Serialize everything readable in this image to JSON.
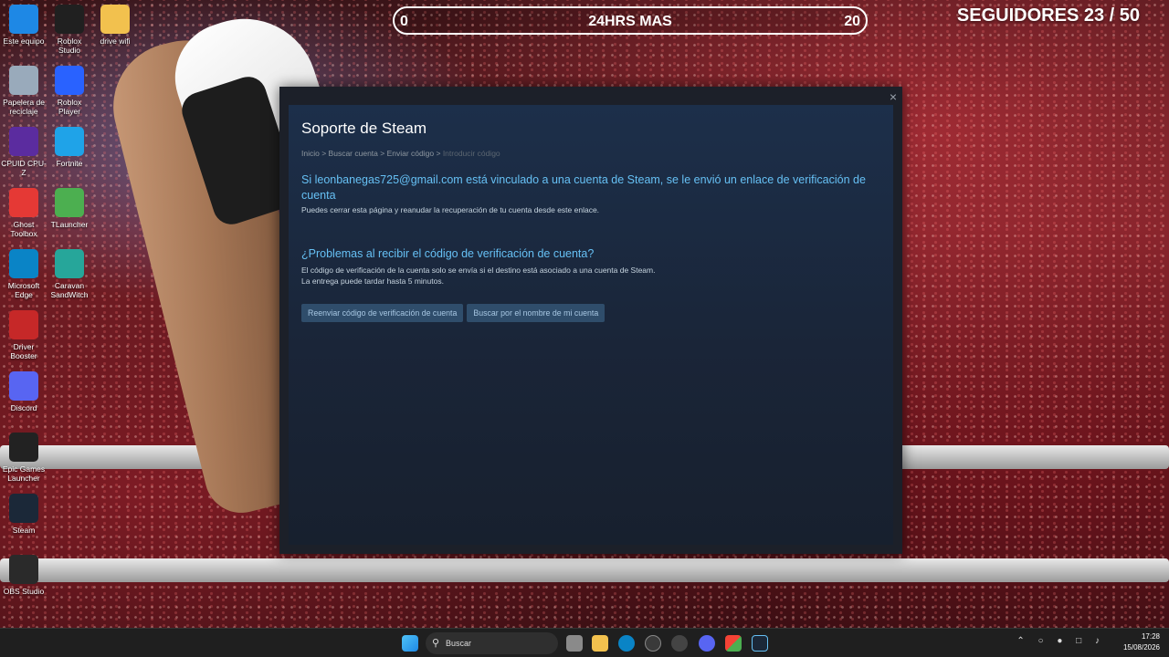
{
  "overlay": {
    "timer_left": "0",
    "timer_title": "24HRS MAS",
    "timer_right": "20",
    "followers": "SEGUIDORES 23 / 50"
  },
  "desktop_icons": [
    {
      "label": "Este equipo",
      "icon": "monitor-icon",
      "color": "#1e88e5"
    },
    {
      "label": "Roblox Studio",
      "icon": "roblox-studio-icon",
      "color": "#202020"
    },
    {
      "label": "drive wifi",
      "icon": "folder-icon",
      "color": "#f2c14e"
    },
    {
      "label": "Papelera de reciclaje",
      "icon": "recycle-bin-icon",
      "color": "#9ab"
    },
    {
      "label": "Roblox Player",
      "icon": "roblox-player-icon",
      "color": "#2962ff"
    },
    {
      "label": "CPUID CPU-Z",
      "icon": "cpu-z-icon",
      "color": "#5b2c9f"
    },
    {
      "label": "Fortnite",
      "icon": "fortnite-icon",
      "color": "#1fa3e8"
    },
    {
      "label": "Ghost Toolbox",
      "icon": "ghost-toolbox-icon",
      "color": "#e53935"
    },
    {
      "label": "TLauncher",
      "icon": "tlauncher-icon",
      "color": "#4caf50"
    },
    {
      "label": "Microsoft Edge",
      "icon": "edge-icon",
      "color": "#0a84c6"
    },
    {
      "label": "Caravan SandWitch",
      "icon": "caravan-sandwitch-icon",
      "color": "#26a69a"
    },
    {
      "label": "Driver Booster",
      "icon": "driver-booster-icon",
      "color": "#c62828"
    },
    {
      "label": "Discord",
      "icon": "discord-icon",
      "color": "#5865f2"
    },
    {
      "label": "Epic Games Launcher",
      "icon": "epic-games-icon",
      "color": "#222"
    },
    {
      "label": "Steam",
      "icon": "steam-icon",
      "color": "#1b2838"
    },
    {
      "label": "OBS Studio",
      "icon": "obs-icon",
      "color": "#2a2a2a"
    }
  ],
  "dialog": {
    "title": "Soporte de Steam",
    "breadcrumb": [
      "Inicio",
      "Buscar cuenta",
      "Enviar código",
      "Introducir código"
    ],
    "headline": "Si leonbanegas725@gmail.com está vinculado a una cuenta de Steam, se le envió un enlace de verificación de cuenta",
    "headline_sub": "Puedes cerrar esta página y reanudar la recuperación de tu cuenta desde este enlace.",
    "problems_title": "¿Problemas al recibir el código de verificación de cuenta?",
    "problems_line1": "El código de verificación de la cuenta solo se envía si el destino está asociado a una cuenta de Steam.",
    "problems_line2": "La entrega puede tardar hasta 5 minutos.",
    "btn_resend": "Reenviar código de verificación de cuenta",
    "btn_search": "Buscar por el nombre de mi cuenta",
    "close": "×"
  },
  "taskbar": {
    "search_placeholder": "Buscar",
    "time": "17:28",
    "date": "15/08/2026"
  }
}
